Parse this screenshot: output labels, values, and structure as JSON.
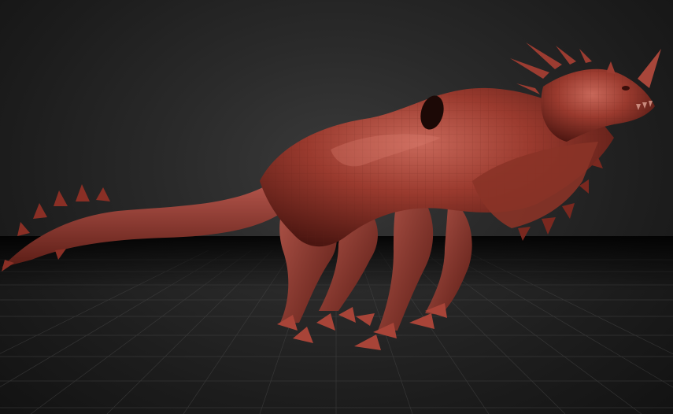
{
  "viewport": {
    "background_color": "#2a2a2a",
    "floor_grid": true,
    "floor_grid_color": "#4a4a4a"
  },
  "model": {
    "subject": "dragon-sculpt",
    "material_color": "#8e3328",
    "highlight_color": "#c0574a",
    "shadow_color": "#4a1510"
  }
}
